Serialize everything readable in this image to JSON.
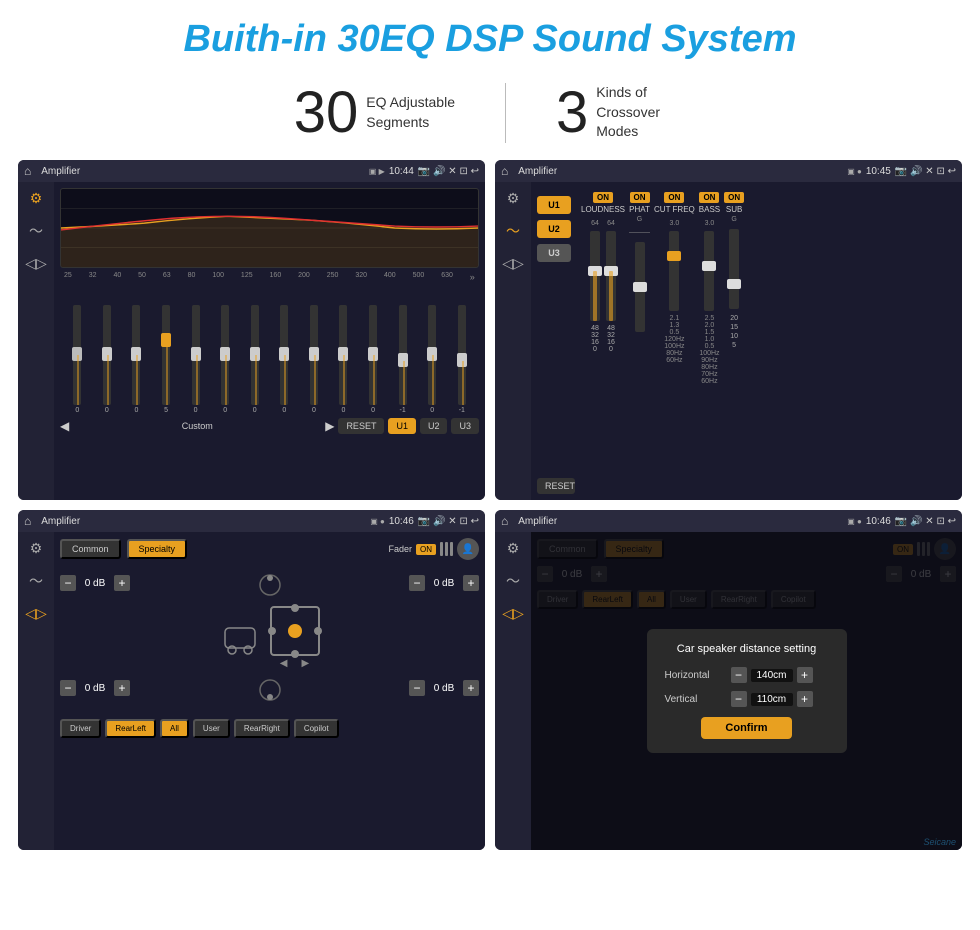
{
  "header": {
    "title": "Buith-in 30EQ DSP Sound System"
  },
  "stats": [
    {
      "number": "30",
      "text": "EQ Adjustable\nSegments"
    },
    {
      "number": "3",
      "text": "Kinds of\nCrossover Modes"
    }
  ],
  "screens": [
    {
      "id": "eq-screen",
      "topbar": {
        "title": "Amplifier",
        "time": "10:44"
      },
      "eq_labels": [
        "25",
        "32",
        "40",
        "50",
        "63",
        "80",
        "100",
        "125",
        "160",
        "200",
        "250",
        "320",
        "400",
        "500",
        "630"
      ],
      "eq_values": [
        "0",
        "0",
        "0",
        "5",
        "0",
        "0",
        "0",
        "0",
        "0",
        "0",
        "0",
        "-1",
        "0",
        "-1"
      ],
      "bottom_buttons": [
        "Custom",
        "RESET",
        "U1",
        "U2",
        "U3"
      ]
    },
    {
      "id": "crossover-screen",
      "topbar": {
        "title": "Amplifier",
        "time": "10:45"
      },
      "presets": [
        "U1",
        "U2",
        "U3"
      ],
      "channels": [
        {
          "label": "LOUDNESS",
          "on": true
        },
        {
          "label": "PHAT",
          "on": true
        },
        {
          "label": "CUT FREQ",
          "on": true
        },
        {
          "label": "BASS",
          "on": true
        },
        {
          "label": "SUB",
          "on": true
        }
      ]
    },
    {
      "id": "amplifier-screen",
      "topbar": {
        "title": "Amplifier",
        "time": "10:46"
      },
      "tabs": [
        "Common",
        "Specialty"
      ],
      "active_tab": "Specialty",
      "fader_label": "Fader",
      "fader_on": "ON",
      "speaker_controls": [
        {
          "label": "0 dB",
          "position": "top-left"
        },
        {
          "label": "0 dB",
          "position": "top-right"
        },
        {
          "label": "0 dB",
          "position": "bottom-left"
        },
        {
          "label": "0 dB",
          "position": "bottom-right"
        }
      ],
      "bottom_buttons": [
        "Driver",
        "RearLeft",
        "All",
        "User",
        "RearRight",
        "Copilot"
      ]
    },
    {
      "id": "distance-screen",
      "topbar": {
        "title": "Amplifier",
        "time": "10:46"
      },
      "tabs": [
        "Common",
        "Specialty"
      ],
      "dialog": {
        "title": "Car speaker distance setting",
        "horizontal_label": "Horizontal",
        "horizontal_value": "140cm",
        "vertical_label": "Vertical",
        "vertical_value": "110cm",
        "confirm_label": "Confirm"
      },
      "bottom_buttons": [
        "Driver",
        "RearLeft",
        "All",
        "User",
        "RearRight",
        "Copilot"
      ],
      "speaker_controls": [
        {
          "label": "0 dB"
        },
        {
          "label": "0 dB"
        }
      ]
    }
  ],
  "watermark": "Seicane"
}
